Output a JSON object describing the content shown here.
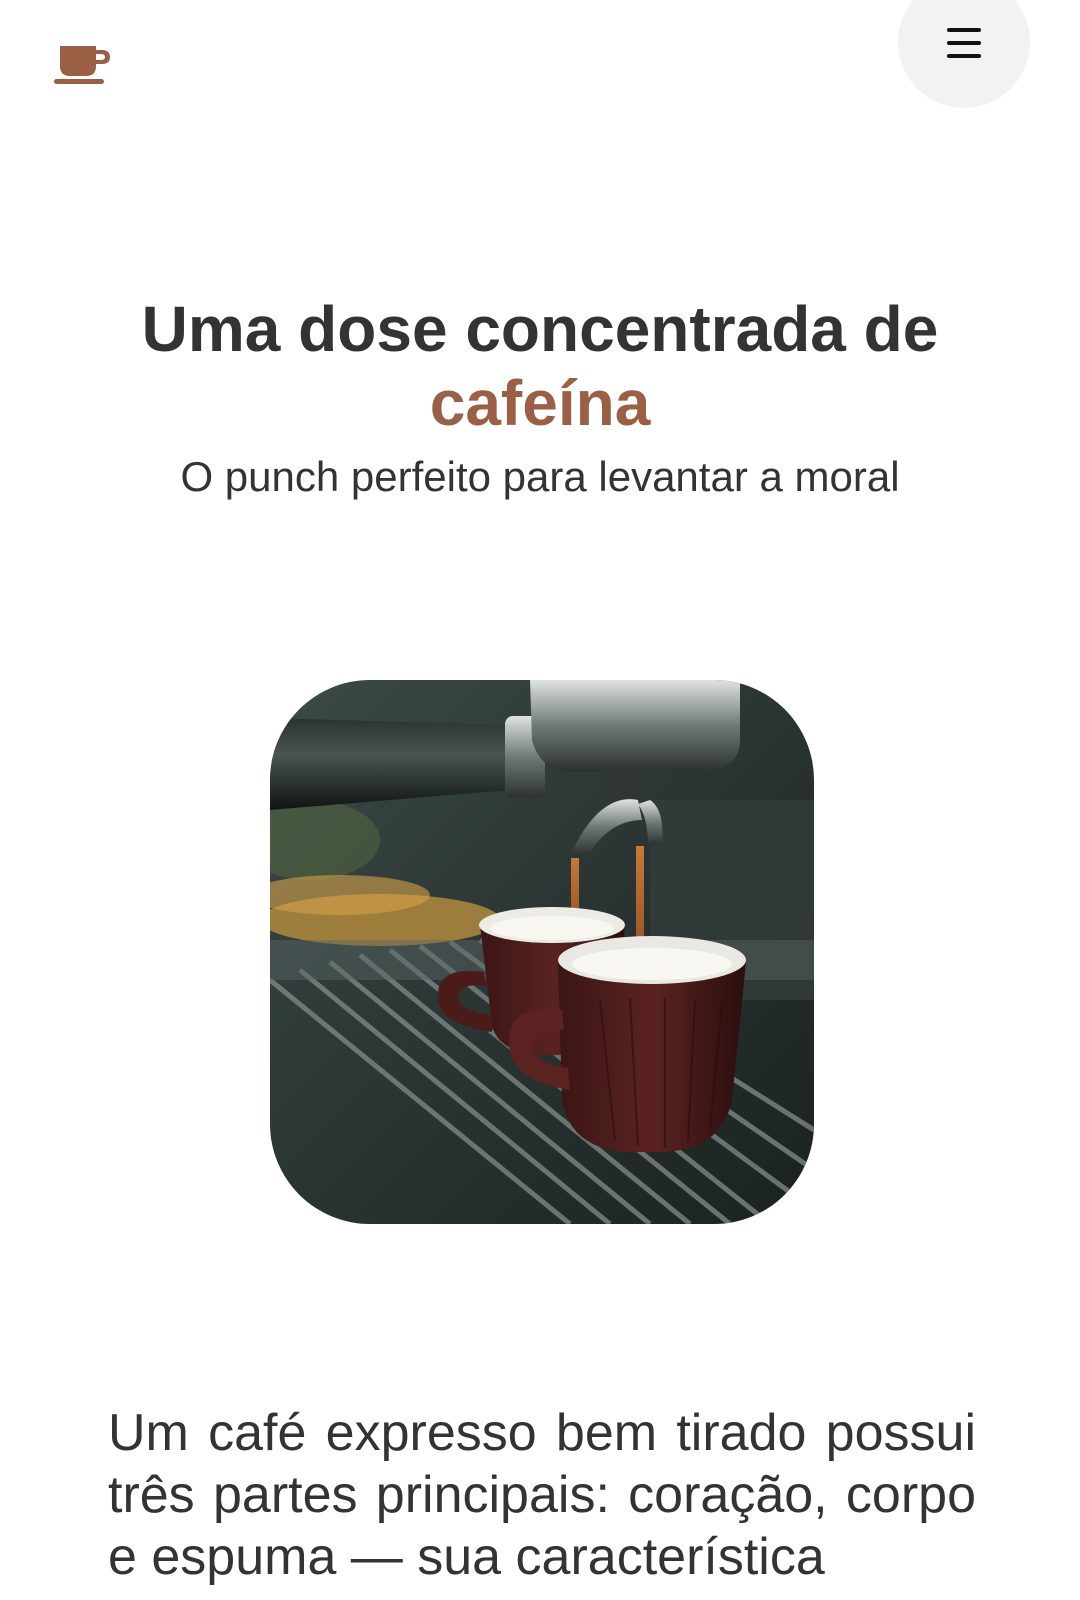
{
  "header": {
    "logo_icon": "coffee-cup-icon",
    "menu_icon": "hamburger-menu-icon",
    "accent_color": "#9a5f45"
  },
  "hero": {
    "title_line": "Uma dose concentrada de",
    "title_accent": "cafeína",
    "subtitle": "O punch perfeito para levantar a moral",
    "image_icon": "espresso-machine-image"
  },
  "content": {
    "paragraph": "Um café expresso bem tirado possui três partes principais: coração, corpo e espuma — sua característica"
  }
}
